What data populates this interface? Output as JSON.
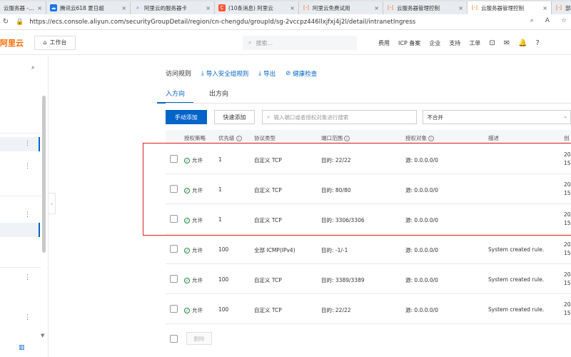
{
  "browser": {
    "tabs": [
      {
        "title": "云服务器 - 腾",
        "icon": "server-icon",
        "color": "#ff6a00"
      },
      {
        "title": "腾讯云618 夏日超",
        "icon": "cloud-icon",
        "color": "#1a73e8"
      },
      {
        "title": "阿里云的服务器卡",
        "icon": "search-icon",
        "color": "#1a73e8"
      },
      {
        "title": "(10条消息) 阿里云",
        "icon": "csdn-icon",
        "color": "#fc5531"
      },
      {
        "title": "阿里云免费试用",
        "icon": "aliyun-icon",
        "color": "#ff6a00"
      },
      {
        "title": "云服务器管理控制",
        "icon": "aliyun-icon",
        "color": "#ff6a00"
      },
      {
        "title": "云服务器管理控制",
        "icon": "aliyun-icon",
        "color": "#ff6a00",
        "active": true
      },
      {
        "title": "部署",
        "icon": "aliyun-icon",
        "color": "#ff6a00"
      }
    ],
    "url": "https://ecs.console.aliyun.com/securityGroupDetail/region/cn-chengdu/groupId/sg-2vccpz446llxjfxj4j2l/detail/intranetIngress"
  },
  "topbar": {
    "logo": "阿里云",
    "workbench": "工作台",
    "search_placeholder": "搜索...",
    "links": [
      "费用",
      "ICP 备案",
      "企业",
      "支持",
      "工单"
    ]
  },
  "main": {
    "title": "访问规则",
    "links": [
      "导入安全组规则",
      "导出",
      "健康检查"
    ],
    "tabs": [
      "入方向",
      "出方向"
    ],
    "toolbar": {
      "add_button": "手动添加",
      "quick_add_button": "快速添加",
      "search_placeholder": "输入端口或者授权对象进行搜索",
      "select_value": "不合并"
    },
    "columns": [
      "授权策略",
      "优先级",
      "协议类型",
      "端口范围",
      "授权对象",
      "描述",
      "创"
    ],
    "rows": [
      {
        "policy": "允许",
        "priority": "1",
        "protocol": "自定义 TCP",
        "port": "目的: 22/22",
        "source": "源: 0.0.0.0/0",
        "desc": "",
        "date": [
          "20",
          "15"
        ]
      },
      {
        "policy": "允许",
        "priority": "1",
        "protocol": "自定义 TCP",
        "port": "目的: 80/80",
        "source": "源: 0.0.0.0/0",
        "desc": "",
        "date": [
          "20",
          "15"
        ]
      },
      {
        "policy": "允许",
        "priority": "1",
        "protocol": "自定义 TCP",
        "port": "目的: 3306/3306",
        "source": "源: 0.0.0.0/0",
        "desc": "",
        "date": [
          "20",
          "15"
        ]
      },
      {
        "policy": "允许",
        "priority": "100",
        "protocol": "全部 ICMP(IPv4)",
        "port": "目的: -1/-1",
        "source": "源: 0.0.0.0/0",
        "desc": "System created rule.",
        "date": [
          "20",
          "15"
        ]
      },
      {
        "policy": "允许",
        "priority": "100",
        "protocol": "自定义 TCP",
        "port": "目的: 3389/3389",
        "source": "源: 0.0.0.0/0",
        "desc": "System created rule.",
        "date": [
          "20",
          "15"
        ]
      },
      {
        "policy": "允许",
        "priority": "100",
        "protocol": "自定义 TCP",
        "port": "目的: 22/22",
        "source": "源: 0.0.0.0/0",
        "desc": "System created rule.",
        "date": [
          "20",
          "15"
        ]
      }
    ],
    "delete_button": "删除"
  },
  "colors": {
    "accent": "#0064c8",
    "brand": "#ff6a00",
    "allow": "#1e8e3e",
    "highlight": "#e02020"
  }
}
